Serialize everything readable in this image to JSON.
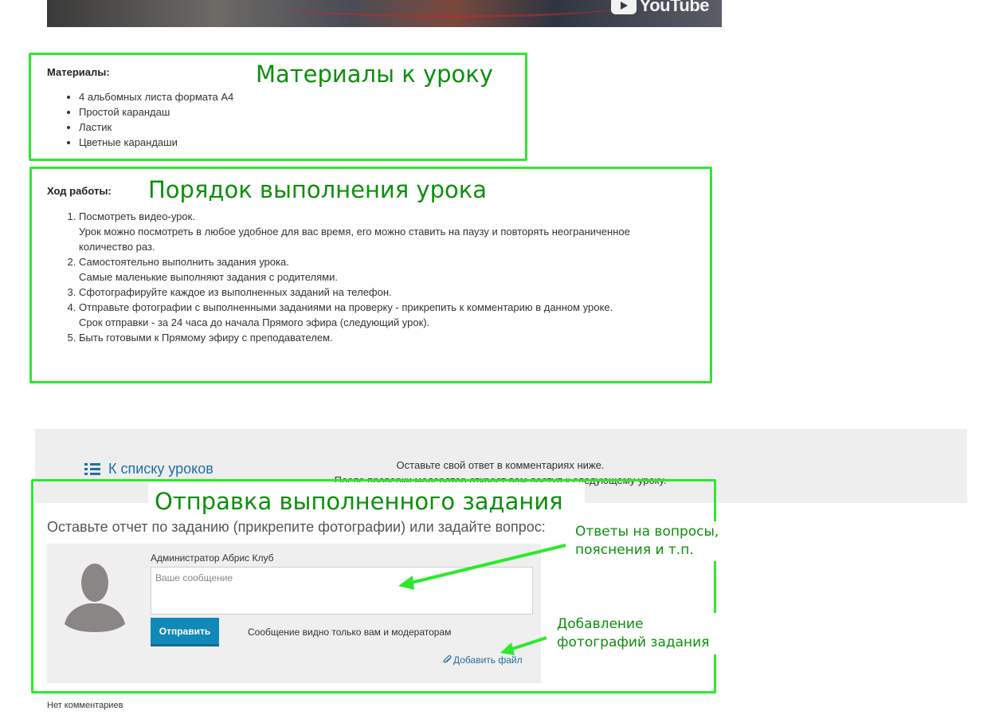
{
  "video": {
    "logo_text": "YouTube"
  },
  "materials": {
    "heading": "Материалы:",
    "annotation": "Материалы к уроку",
    "items": [
      "4 альбомных листа формата А4",
      "Простой карандаш",
      "Ластик",
      "Цветные карандаши"
    ]
  },
  "workflow": {
    "heading": "Ход работы:",
    "annotation": "Порядок выполнения урока",
    "steps": [
      {
        "line1": "Посмотреть видео-урок.",
        "line2": "Урок можно посмотреть в любое удобное для вас время, его можно ставить на паузу и повторять неограниченное",
        "line3": "количество раз."
      },
      {
        "line1": "Самостоятельно выполнить задания урока.",
        "line2": "Самые маленькие выполняют задания с родителями."
      },
      {
        "line1": "Сфотографируйте каждое из выполненных заданий на телефон."
      },
      {
        "line1": "Отправьте фотографии с выполненными заданиями на проверку - прикрепить к комментарию в данном уроке.",
        "line2": "Срок отправки - за 24 часа до начала Прямого эфира (следующий урок)."
      },
      {
        "line1": "Быть готовыми к Прямому эфиру с преподавателем."
      }
    ]
  },
  "nav": {
    "back_link": "К списку уроков",
    "note_line1": "Оставьте свой ответ в комментариях ниже.",
    "note_line2": "После проверки модератор откроет вам доступ к следующему уроку."
  },
  "submission": {
    "annotation": "Отправка выполненного задания",
    "prompt": "Оставьте отчет по заданию (прикрепите фотографии) или задайте вопрос:",
    "author": "Администратор Абрис Клуб",
    "message_placeholder": "Ваше сообщение",
    "send_button": "Отправить",
    "visibility_note": "Сообщение видно только вам и модераторам",
    "add_file": "Добавить файл",
    "annotation_answers_line1": "Ответы на вопросы,",
    "annotation_answers_line2": "пояснения и т.п.",
    "annotation_photos_line1": "Добавление",
    "annotation_photos_line2": "фотографий задания",
    "no_comments": "Нет комментариев"
  },
  "colors": {
    "highlight_green": "#2ee82e",
    "annotation_text": "#0d8f0d",
    "link_blue": "#1f6fa6",
    "button_blue": "#1088b8"
  }
}
